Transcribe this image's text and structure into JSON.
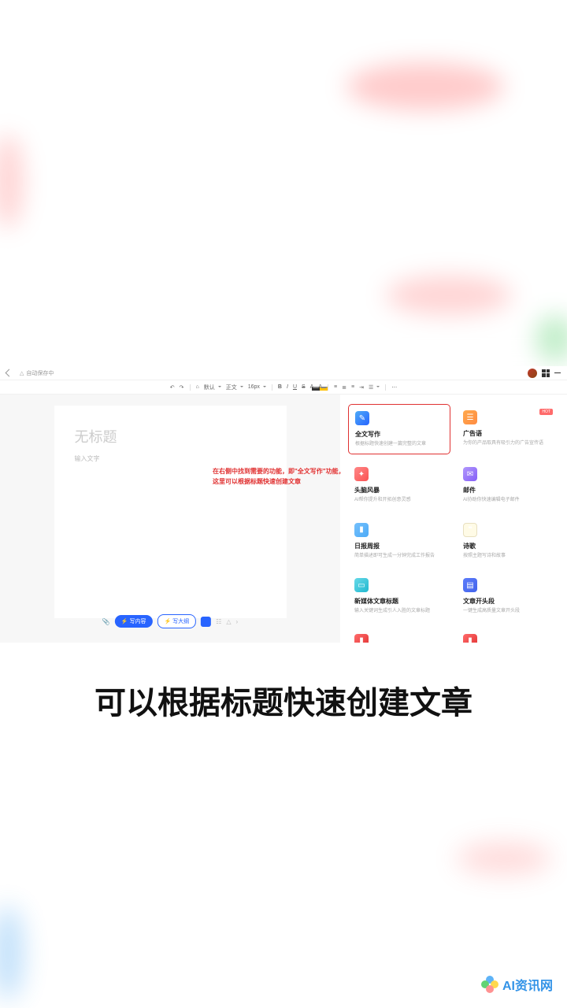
{
  "topbar": {
    "autosave": "自动保存中"
  },
  "toolbar": {
    "font": "默认",
    "para": "正文",
    "size": "16px",
    "b": "B",
    "i": "I",
    "u": "U",
    "s": "S",
    "a": "A",
    "h": "A"
  },
  "doc": {
    "title_placeholder": "无标题",
    "body_placeholder": "输入文字"
  },
  "note": {
    "line1": "在右侧中找到需要的功能，即\"全文写作\"功能，",
    "line2": "这里可以根据标题快速创建文章"
  },
  "buttons": {
    "fulltext": "⚡ 写内容",
    "outline": "⚡ 写大纲"
  },
  "cards": [
    {
      "title": "全文写作",
      "desc": "根据标题快速创建一篇完整的文章",
      "icon": "icon-blue",
      "glyph": "✎",
      "hl": true
    },
    {
      "title": "广告语",
      "desc": "为你的产品取具有吸引力的广告宣传语",
      "icon": "icon-orange",
      "glyph": "☰",
      "badge": "HOT"
    },
    {
      "title": "头脑风暴",
      "desc": "AI帮你提升和开拓创意灵感",
      "icon": "icon-red",
      "glyph": "✦"
    },
    {
      "title": "邮件",
      "desc": "AI协助你快速编辑电子邮件",
      "icon": "icon-purple",
      "glyph": "✉"
    },
    {
      "title": "日报周报",
      "desc": "简单描述即可生成一分钟完成工作报告",
      "icon": "icon-lblue",
      "glyph": "▮"
    },
    {
      "title": "诗歌",
      "desc": "按照主题写诗和故事",
      "icon": "icon-paper",
      "glyph": "❝"
    },
    {
      "title": "新媒体文章标题",
      "desc": "输入关键词生成引人入胜的文章标题",
      "icon": "icon-teal",
      "glyph": "▭"
    },
    {
      "title": "文章开头段",
      "desc": "一键生成高质量文章开头段",
      "icon": "icon-navy",
      "glyph": "▤"
    },
    {
      "title": "",
      "desc": "",
      "icon": "icon-red2",
      "glyph": "▮"
    },
    {
      "title": "",
      "desc": "",
      "icon": "icon-red2",
      "glyph": "▮"
    }
  ],
  "caption": "可以根据标题快速创建文章",
  "watermark": "AI资讯网"
}
